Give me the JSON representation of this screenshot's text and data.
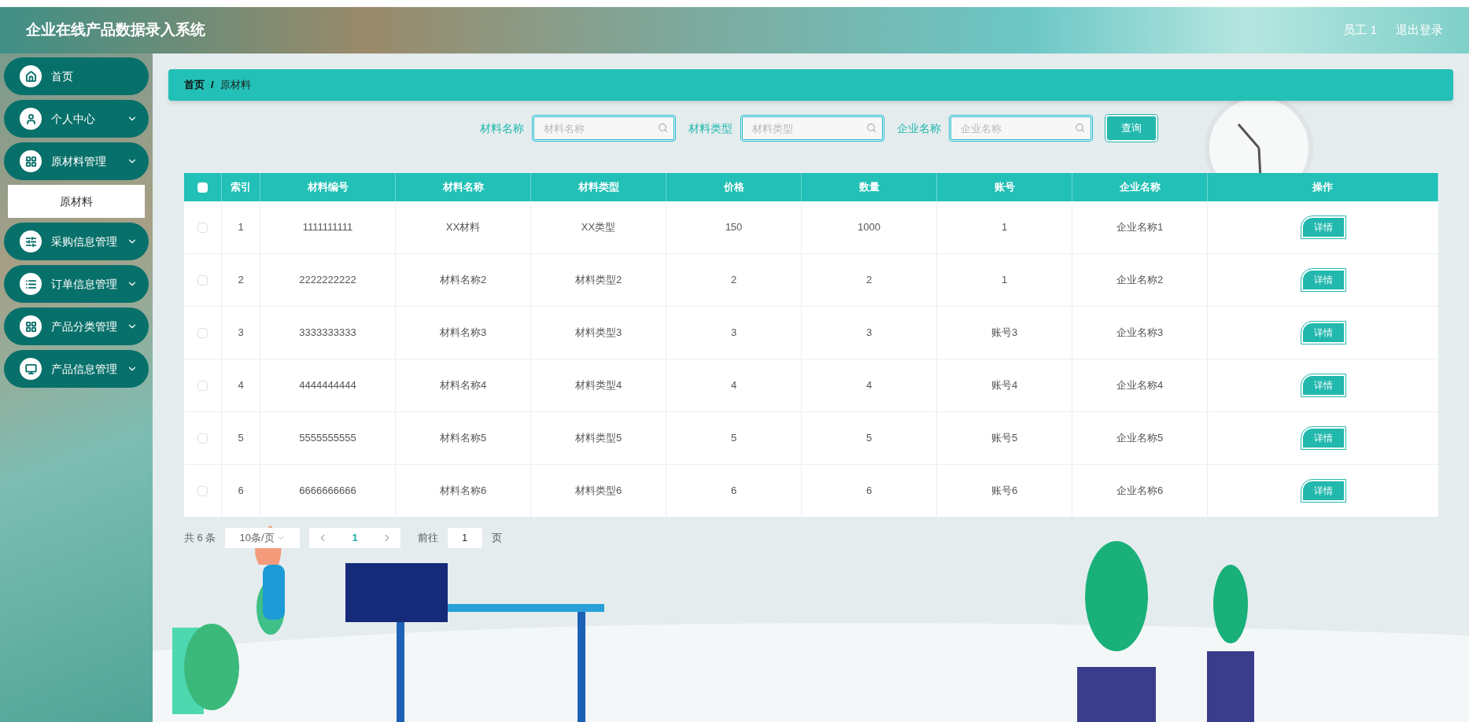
{
  "header": {
    "title": "企业在线产品数据录入系统",
    "user": "员工 1",
    "logout": "退出登录"
  },
  "sidebar": {
    "items": [
      {
        "label": "首页",
        "expandable": false
      },
      {
        "label": "个人中心",
        "expandable": true
      },
      {
        "label": "原材料管理",
        "expandable": true,
        "children": [
          {
            "label": "原材料",
            "selected": true
          }
        ]
      },
      {
        "label": "采购信息管理",
        "expandable": true
      },
      {
        "label": "订单信息管理",
        "expandable": true
      },
      {
        "label": "产品分类管理",
        "expandable": true
      },
      {
        "label": "产品信息管理",
        "expandable": true
      }
    ]
  },
  "breadcrumb": {
    "items": [
      "首页",
      "原材料"
    ],
    "separator": "/"
  },
  "search": {
    "fields": [
      {
        "label": "材料名称",
        "placeholder": "材料名称"
      },
      {
        "label": "材料类型",
        "placeholder": "材料类型"
      },
      {
        "label": "企业名称",
        "placeholder": "企业名称"
      }
    ],
    "button": "查询"
  },
  "table": {
    "select_all": false,
    "columns": [
      "索引",
      "材料编号",
      "材料名称",
      "材料类型",
      "价格",
      "数量",
      "账号",
      "企业名称",
      "操作"
    ],
    "rows": [
      {
        "checked": false,
        "cells": [
          "1",
          "1111111111",
          "XX材料",
          "XX类型",
          "150",
          "1000",
          "1",
          "企业名称1"
        ],
        "action": "详情"
      },
      {
        "checked": false,
        "cells": [
          "2",
          "2222222222",
          "材料名称2",
          "材料类型2",
          "2",
          "2",
          "1",
          "企业名称2"
        ],
        "action": "详情"
      },
      {
        "checked": false,
        "cells": [
          "3",
          "3333333333",
          "材料名称3",
          "材料类型3",
          "3",
          "3",
          "账号3",
          "企业名称3"
        ],
        "action": "详情"
      },
      {
        "checked": false,
        "cells": [
          "4",
          "4444444444",
          "材料名称4",
          "材料类型4",
          "4",
          "4",
          "账号4",
          "企业名称4"
        ],
        "action": "详情"
      },
      {
        "checked": false,
        "cells": [
          "5",
          "5555555555",
          "材料名称5",
          "材料类型5",
          "5",
          "5",
          "账号5",
          "企业名称5"
        ],
        "action": "详情"
      },
      {
        "checked": false,
        "cells": [
          "6",
          "6666666666",
          "材料名称6",
          "材料类型6",
          "6",
          "6",
          "账号6",
          "企业名称6"
        ],
        "action": "详情"
      }
    ]
  },
  "pagination": {
    "total": "共 6 条",
    "page_size": "10条/页",
    "current_page": "1",
    "goto_label": "前往",
    "goto_value": "1",
    "goto_suffix": "页"
  }
}
